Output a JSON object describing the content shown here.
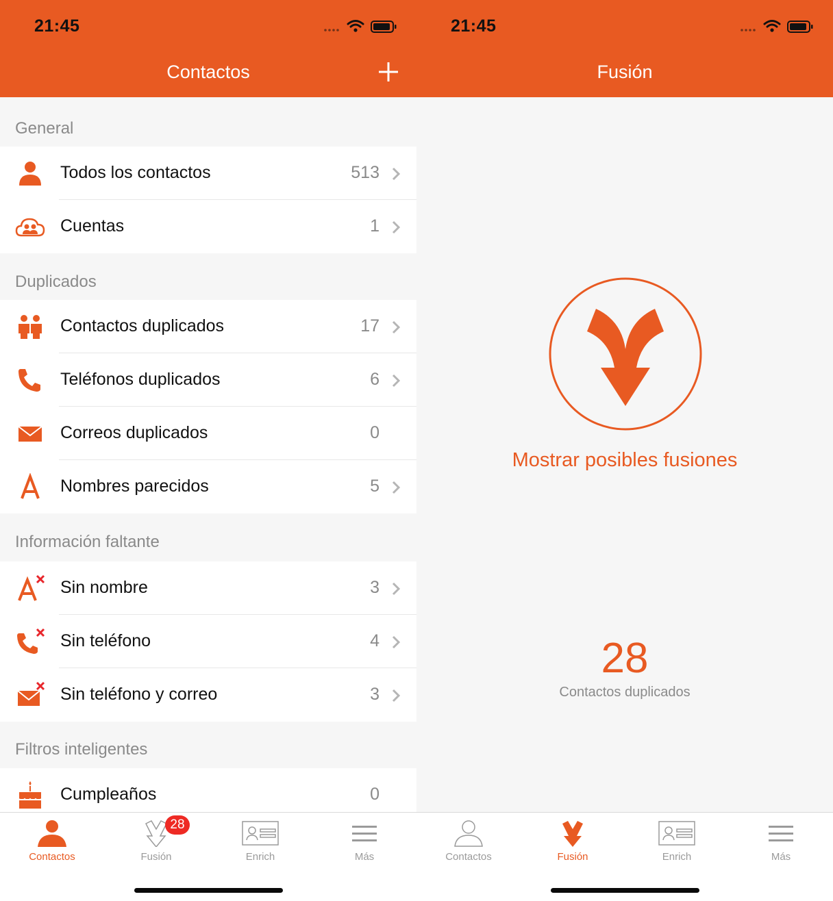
{
  "colors": {
    "accent": "#e85a22",
    "badge": "#ee2a24",
    "muted": "#9a9a9a"
  },
  "status_bar": {
    "time": "21:45"
  },
  "left": {
    "title": "Contactos",
    "sections": [
      {
        "label": "General"
      },
      {
        "label": "Duplicados"
      },
      {
        "label": "Información faltante"
      },
      {
        "label": "Filtros inteligentes"
      }
    ],
    "rows": [
      {
        "label": "Todos los contactos",
        "count": "513",
        "icon": "person-icon"
      },
      {
        "label": "Cuentas",
        "count": "1",
        "icon": "cloud-people-icon"
      },
      {
        "label": "Contactos duplicados",
        "count": "17",
        "icon": "two-people-icon"
      },
      {
        "label": "Teléfonos duplicados",
        "count": "6",
        "icon": "phone-icon"
      },
      {
        "label": "Correos duplicados",
        "count": "0",
        "icon": "envelope-icon"
      },
      {
        "label": "Nombres parecidos",
        "count": "5",
        "icon": "letter-a-icon"
      },
      {
        "label": "Sin nombre",
        "count": "3",
        "icon": "letter-a-x-icon"
      },
      {
        "label": "Sin teléfono",
        "count": "4",
        "icon": "phone-x-icon"
      },
      {
        "label": "Sin teléfono y correo",
        "count": "3",
        "icon": "envelope-x-icon"
      },
      {
        "label": "Cumpleaños",
        "count": "0",
        "icon": "cake-icon"
      }
    ],
    "badge_count": "28"
  },
  "right": {
    "title": "Fusión",
    "action_label": "Mostrar posibles fusiones",
    "duplicate_count": "28",
    "duplicate_label": "Contactos duplicados"
  },
  "tabs": [
    {
      "label": "Contactos",
      "icon": "person-icon"
    },
    {
      "label": "Fusión",
      "icon": "merge-arrow-icon"
    },
    {
      "label": "Enrich",
      "icon": "id-card-icon"
    },
    {
      "label": "Más",
      "icon": "menu-icon"
    }
  ]
}
